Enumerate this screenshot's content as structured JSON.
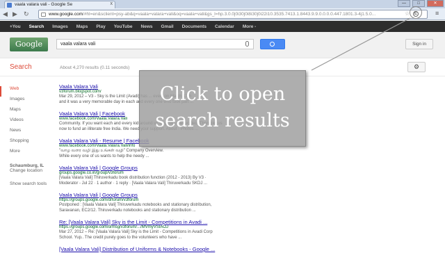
{
  "browser": {
    "tab_title": "vaala valara vali - Google Se",
    "tab_close": "x",
    "url_host": "www.google.com",
    "url_rest": "/#hl=en&sclient=psy-ab&q=vaala+valara+vali&oq=vaala+vali&gs_l=hp.3.0.0j0i30j0i8i30j0i22i10.3535.7413.1.8443.9.9.0.0.0.0.447.1801.3-4j1.5.0...",
    "ext_icon_label": "E",
    "window_controls": {
      "min": "—",
      "max": "□",
      "close": "✕"
    }
  },
  "gbar": {
    "items": [
      "+You",
      "Search",
      "Images",
      "Maps",
      "Play",
      "YouTube",
      "News",
      "Gmail",
      "Documents",
      "Calendar",
      "More -"
    ]
  },
  "header": {
    "logo_text": "Google",
    "search_value": "vaala valara vali",
    "sign_in": "Sign in"
  },
  "subheader": {
    "title": "Search",
    "stats": "About 4,270 results (0.11 seconds)",
    "gear": "⚙"
  },
  "leftnav": {
    "items": [
      "Web",
      "Images",
      "Maps",
      "Videos",
      "News",
      "Shopping",
      "More"
    ],
    "location": "Schaumburg, IL",
    "change_location": "Change location",
    "tools": "Show search tools"
  },
  "results": [
    {
      "title": "Vaala Valara Vali",
      "url": "v3forum.blogspot.com/",
      "snippet1": "Mar 29, 2012 – V3 - Sky is the Limit (Avadi) has ... event on March 17th",
      "snippet2": "and it was a very memorable day in each and every one who took part ..."
    },
    {
      "title": "Vaala Valara Vali | Facebook",
      "url": "www.facebook.com/Vaala.Valara.Vali",
      "snippet1": "Community. If you want each and every kid around us to grow up educated. Then join us",
      "snippet2": "now to fund an illiterate free India. We need your support. About · Photos ..."
    },
    {
      "title": "Vaala Valara Vali - Resume | Facebook",
      "url": "www.facebook.com/Vaala.Valara.Vali/info",
      "snippet1": "\"வாழ வளர வழி இது உங்கள் வழி\" Company Overview.",
      "snippet2": "While every one of us wants to help the needy ..."
    },
    {
      "title": "Vaala Valara Vali | Google Groups",
      "url": "groups.google.co.in/group/v3forum",
      "snippet1": "[Vaala Valara Vali] Thiruverkadu book distribution function (2012 - 2013) By V3 ·",
      "snippet2": "Moderator - Jul 22 · 1 author · 1 reply · [Vaala Valara Vali] Thiruverkadu SKDJ ..."
    },
    {
      "title": "Vaala Valara Vali | Google Groups",
      "url": "https://groups.google.com/d/forum/v3forum",
      "snippet1": "Postponed : [Vaala Valara Vali] Thiruverkadu notebooks and stationary distribution,",
      "snippet2": "Saravanan, EC2/12. Thiruverkadu notebooks and stationary distribution ..."
    },
    {
      "title": "Re: [Vaala Valara Vali] Sky is the Limit - Competitions in Avadi ...",
      "url": "https://groups.google.com/d/msg/v3forum/.../MVmyVSIAOJ",
      "snippet1": "Mar 27, 2012 – Re: [Vaala Valara Vali] Sky is the Limit - Competitions in Avadi Corp",
      "snippet2": "School. Yup.. The credit purely goes to the volunteers who have ..."
    },
    {
      "title": "[Vaala Valara Vali] Distribution of Uniforms & Notebooks - Google ...",
      "url": "",
      "snippet1": "",
      "snippet2": ""
    }
  ],
  "callout": {
    "line1": "Click to open",
    "line2": "search results"
  }
}
